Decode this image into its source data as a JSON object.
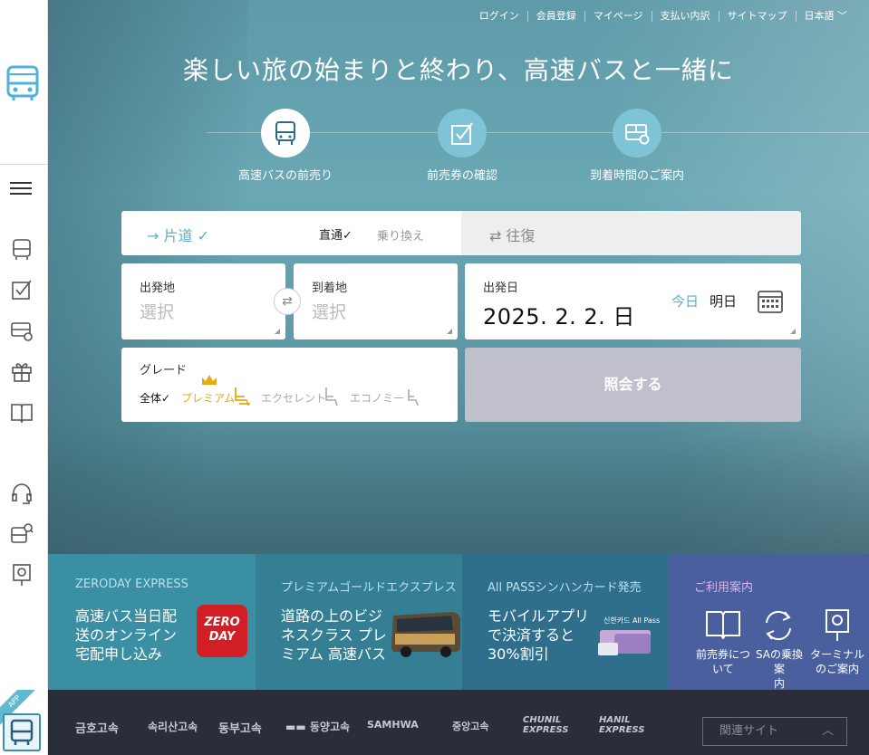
{
  "colors": {
    "hero_bg": "#6aa8b4",
    "accent": "#5aaed0",
    "premium": "#e6a817",
    "query_btn": "#bfc0cc",
    "promo1": "#3a8fa2",
    "promo2": "#357f95",
    "promo3": "#2f6f8c",
    "promo4": "#4a5f9e",
    "footer": "#2a2d3a"
  },
  "sidebar": {
    "icons": [
      "bus-logo-icon",
      "menu-icon",
      "bus-icon",
      "checkbox-icon",
      "bus-time-icon",
      "gift-icon",
      "book-icon",
      "headset-icon",
      "bus-search-icon",
      "terminal-pin-icon"
    ],
    "app_badge": "APP"
  },
  "topnav": {
    "items": [
      "ログイン",
      "会員登録",
      "マイページ",
      "支払い内訳",
      "サイトマップ"
    ],
    "language": "日本語"
  },
  "hero": {
    "title": "楽しい旅の始まりと終わり、高速バスと一緒に",
    "services": [
      {
        "label": "高速バスの前売り",
        "icon": "bus-icon",
        "active": true
      },
      {
        "label": "前売券の確認",
        "icon": "checkbox-icon",
        "active": false
      },
      {
        "label": "到着時間のご案内",
        "icon": "bus-time-icon",
        "active": false
      }
    ]
  },
  "search": {
    "oneway_label": "→ 片道 ✓",
    "direct_label": "直通✓",
    "transfer_label": "乗り換え",
    "roundtrip_label": "⇄ 往復",
    "departure": {
      "label": "出発地",
      "placeholder": "選択"
    },
    "arrival": {
      "label": "到着地",
      "placeholder": "選択"
    },
    "date": {
      "label": "出発日",
      "value": "2025. 2. 2. 日",
      "today": "今日",
      "tomorrow": "明日"
    },
    "grade": {
      "label": "グレード",
      "options": [
        {
          "label": "全体✓",
          "selected": true
        },
        {
          "label": "プレミアム",
          "selected": false
        },
        {
          "label": "エクセレント",
          "selected": false
        },
        {
          "label": "エコノミー",
          "selected": false
        }
      ]
    },
    "query_button": "照会する"
  },
  "promos": [
    {
      "title": "ZERODAY EXPRESS",
      "lines": [
        "高速バス当日配",
        "送のオンライン",
        "宅配申し込み"
      ],
      "badge": "ZERO DAY"
    },
    {
      "title": "プレミアムゴールドエクスプレス",
      "lines": [
        "道路の上のビジ",
        "ネスクラス プレ",
        "ミアム 高速バス"
      ]
    },
    {
      "title": "All PASSシンハンカード発売",
      "lines": [
        "モバイルアプリ",
        "で決済すると",
        "30%割引"
      ],
      "card_label": "신한카드 All Pass"
    },
    {
      "title": "ご利用案内",
      "items": [
        {
          "label1": "前売券につ",
          "label2": "いて",
          "icon": "book-icon"
        },
        {
          "label1": "SAの乗換案",
          "label2": "内",
          "icon": "refresh-icon"
        },
        {
          "label1": "ターミナル",
          "label2": "のご案内",
          "icon": "terminal-pin-icon"
        }
      ]
    }
  ],
  "footer": {
    "logos": [
      "금호고속",
      "속리산고속",
      "동부고속",
      "동양고속",
      "SAMHWA",
      "중앙고속",
      "CHUNIL EXPRESS",
      "HANIL EXPRESS"
    ],
    "related_sites": "関連サイト"
  }
}
